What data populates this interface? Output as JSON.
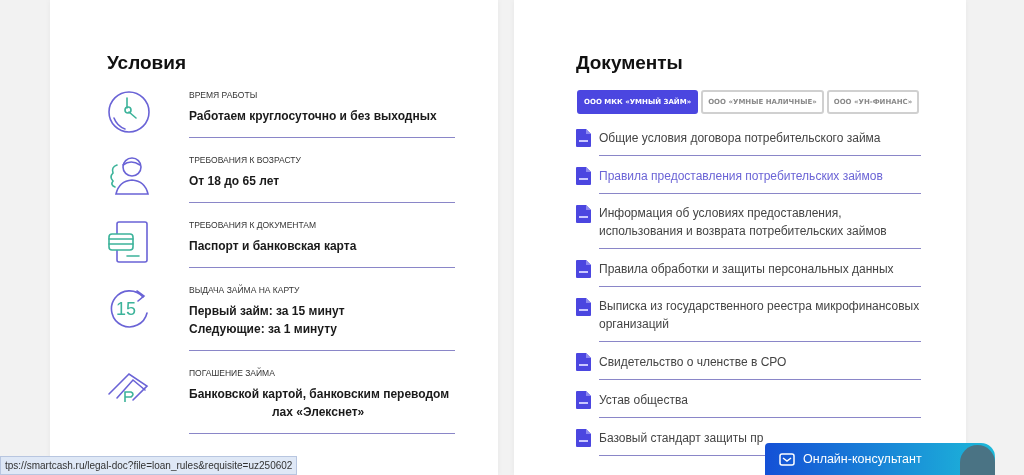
{
  "conditions": {
    "title": "Условия",
    "items": [
      {
        "kind": "clock",
        "label": "ВРЕМЯ РАБОТЫ",
        "lines": [
          {
            "text": "Работаем круглосуточно и без выходных",
            "covered": false
          }
        ]
      },
      {
        "kind": "person",
        "label": "ТРЕБОВАНИЯ К ВОЗРАСТУ",
        "lines": [
          {
            "text": "От 18 до 65 лет",
            "covered": false
          }
        ]
      },
      {
        "kind": "document",
        "label": "ТРЕБОВАНИЯ К ДОКУМЕНТАМ",
        "lines": [
          {
            "text": "Паспорт и банковская карта",
            "covered": false
          }
        ]
      },
      {
        "kind": "timer",
        "icon_text": "15",
        "label": "ВЫДАЧА ЗАЙМА НА КАРТУ",
        "lines": [
          {
            "text": "Первый займ: за 15 минут",
            "covered": false
          },
          {
            "text": "Следующие: за 1 минуту",
            "covered": false
          }
        ]
      },
      {
        "kind": "money",
        "label": "ПОГАШЕНИЕ ЗАЙМА",
        "lines": [
          {
            "text": "Банковской картой, банковским переводом",
            "covered": false
          },
          {
            "text": "лах «Элекснет»",
            "covered": true
          }
        ]
      }
    ]
  },
  "documents": {
    "title": "Документы",
    "tabs": [
      {
        "label": "ООО МКК «УМНЫЙ ЗАЙМ»",
        "selected": true
      },
      {
        "label": "ООО «УМНЫЕ НАЛИЧНЫЕ»",
        "selected": false
      },
      {
        "label": "ООО «УН-ФИНАНС»",
        "selected": false
      }
    ],
    "items": [
      {
        "text": "Общие условия договора потребительского займа",
        "highlighted": false
      },
      {
        "text": "Правила предоставления потребительских займов",
        "highlighted": true
      },
      {
        "text": "Информация об условиях предоставления, использования и возврата потребительских займов",
        "highlighted": false
      },
      {
        "text": "Правила обработки и защиты персональных данных",
        "highlighted": false
      },
      {
        "text": "Выписка из государственного реестра микрофинансовых организаций",
        "highlighted": false
      },
      {
        "text": "Свидетельство о членстве в СРО",
        "highlighted": false
      },
      {
        "text": "Устав общества",
        "highlighted": false
      },
      {
        "text": "Базовый стандарт защиты пр",
        "highlighted": false
      }
    ]
  },
  "status_bar": {
    "url": "tps://smartcash.ru/legal-doc?file=loan_rules&requisite=uz250602"
  },
  "chat_button": {
    "label": "Онлайн-консультант"
  }
}
